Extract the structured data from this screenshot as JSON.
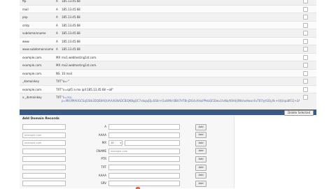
{
  "dns_records": [
    {
      "host": "ftp",
      "type": "A",
      "value": "185.13.45.68"
    },
    {
      "host": "mail",
      "type": "A",
      "value": "185.13.45.68"
    },
    {
      "host": "pop",
      "type": "A",
      "value": "185.13.45.68"
    },
    {
      "host": "smtp",
      "type": "A",
      "value": "185.13.45.68"
    },
    {
      "host": "subdomainname",
      "type": "A",
      "value": "185.13.45.68"
    },
    {
      "host": "www",
      "type": "A",
      "value": "185.13.45.68"
    },
    {
      "host": "www.subdomainname",
      "type": "A",
      "value": "185.13.45.68"
    },
    {
      "host": "example.com.",
      "type": "MX",
      "value": "mx1.webhosting1st.com."
    },
    {
      "host": "example.com.",
      "type": "MX",
      "value": "mx2.webhosting1st.com."
    },
    {
      "host": "example.com.",
      "type": "NS",
      "value": "10 mail"
    },
    {
      "host": "_domainkey",
      "type": "TXT",
      "value": "\"o=-\""
    },
    {
      "host": "example.com.",
      "type": "TXT",
      "value": "\"v=spf1 a mx ip4:185.13.45.68 ~all\""
    },
    {
      "host": "x._domainkey",
      "type": "TXT",
      "value": "\"k=rsa; p=MIGfMA0GCSqGSIb3DQEBAQUAA4GNADCBiQKBgQC7vbqajDjuSSbl+l3uWNVrBBt7HTBnjDG4vXHuPPebQl5Dwx1tvNa/t6hHj0NlslwHwxnFuT87iytGDyXk+UtjUqu8fCQ+3AJzZvNXMpAnQjjKwkY2qbbnLf/7eKvnNXsCx9ZP4f8W3hIrq48GbWmZkTpUrjp2dAI5wVXlQtQWVnCyT/BhPAQIDAQAB\""
    }
  ],
  "toolbar": {
    "delete_label": "Delete Selected"
  },
  "add_panel": {
    "title": "Add Domain Records",
    "add_label": "Add",
    "rows": [
      {
        "type": "A",
        "host_value": "",
        "host_placeholder": "",
        "value_text": ""
      },
      {
        "type": "AAAA",
        "host_value": "example.com",
        "host_placeholder": "",
        "value_text": ""
      },
      {
        "type": "MX",
        "host_value": "example.com",
        "host_placeholder": "",
        "priority": "10",
        "value_text": ""
      },
      {
        "type": "CNAME",
        "host_value": "",
        "host_placeholder": "",
        "value_text": "example.com"
      },
      {
        "type": "PTR",
        "host_value": "",
        "host_placeholder": "",
        "value_text": ""
      },
      {
        "type": "TXT",
        "host_value": "",
        "host_placeholder": "",
        "value_text": ""
      },
      {
        "type": "AAAA",
        "host_value": "",
        "host_placeholder": "",
        "value_text": ""
      },
      {
        "type": "SRV",
        "host_value": "",
        "host_placeholder": "",
        "value_text": ""
      }
    ]
  }
}
